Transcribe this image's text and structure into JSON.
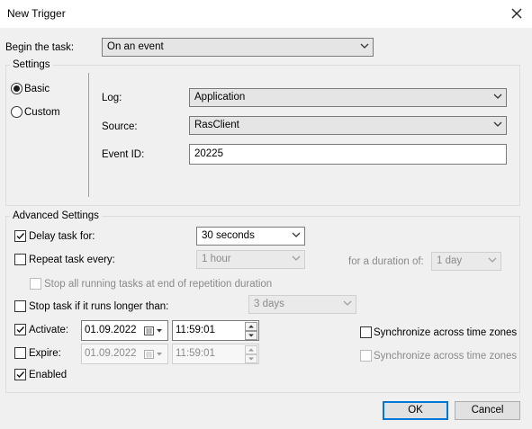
{
  "window": {
    "title": "New Trigger",
    "close_icon": "close-icon"
  },
  "begin": {
    "label": "Begin the task:",
    "value": "On an event"
  },
  "settings": {
    "label": "Settings",
    "basic_label": "Basic",
    "custom_label": "Custom",
    "selected": "Basic",
    "log_label": "Log:",
    "log_value": "Application",
    "source_label": "Source:",
    "source_value": "RasClient",
    "eventid_label": "Event ID:",
    "eventid_value": "20225"
  },
  "advanced": {
    "label": "Advanced Settings",
    "delay_label": "Delay task for:",
    "delay_checked": true,
    "delay_value": "30 seconds",
    "repeat_label": "Repeat task every:",
    "repeat_checked": false,
    "repeat_value": "1 hour",
    "duration_label": "for a duration of:",
    "duration_value": "1 day",
    "stopall_label": "Stop all running tasks at end of repetition duration",
    "stopall_checked": false,
    "stoplonger_label": "Stop task if it runs longer than:",
    "stoplonger_checked": false,
    "stoplonger_value": "3 days",
    "activate_label": "Activate:",
    "activate_checked": true,
    "activate_date": "01.09.2022",
    "activate_time": "11:59:01",
    "sync1_label": "Synchronize across time zones",
    "sync1_checked": false,
    "expire_label": "Expire:",
    "expire_checked": false,
    "expire_date": "01.09.2022",
    "expire_time": "11:59:01",
    "sync2_label": "Synchronize across time zones",
    "sync2_checked": false,
    "enabled_label": "Enabled",
    "enabled_checked": true
  },
  "buttons": {
    "ok": "OK",
    "cancel": "Cancel"
  },
  "colors": {
    "accent": "#0078d7",
    "window_bg": "#f0f0f0"
  }
}
